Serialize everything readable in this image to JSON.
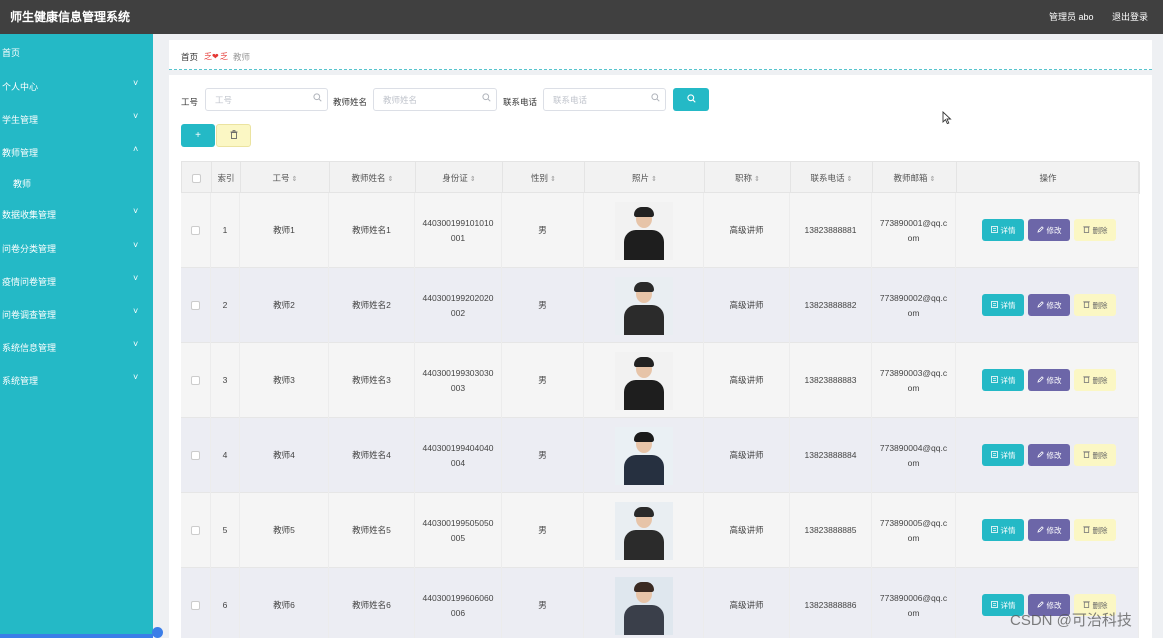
{
  "app": {
    "title": "师生健康信息管理系统",
    "user": "管理员 abo",
    "logout": "退出登录"
  },
  "colors": {
    "accent": "#24b9c6",
    "topbar": "#404040",
    "edit": "#6c66a8",
    "delete": "#fbf7c4"
  },
  "sidebar": {
    "items": [
      {
        "label": "首页",
        "chevron": ""
      },
      {
        "label": "个人中心",
        "chevron": "˅"
      },
      {
        "label": "学生管理",
        "chevron": "˅"
      },
      {
        "label": "教师管理",
        "chevron": "˄"
      },
      {
        "label": "教师",
        "chevron": ""
      },
      {
        "label": "数据收集管理",
        "chevron": "˅"
      },
      {
        "label": "问卷分类管理",
        "chevron": "˅"
      },
      {
        "label": "疫情问卷管理",
        "chevron": "˅"
      },
      {
        "label": "问卷调查管理",
        "chevron": "˅"
      },
      {
        "label": "系统信息管理",
        "chevron": "˅"
      },
      {
        "label": "系统管理",
        "chevron": "˅"
      }
    ]
  },
  "breadcrumb": {
    "home": "首页",
    "separator": "❤",
    "current": "教师"
  },
  "search": {
    "fields": [
      {
        "label": "工号",
        "placeholder": "工号",
        "icon": "search-icon"
      },
      {
        "label": "教师姓名",
        "placeholder": "教师姓名",
        "icon": "search-icon"
      },
      {
        "label": "联系电话",
        "placeholder": "联系电话",
        "icon": "search-icon"
      }
    ],
    "button_icon": "search-icon"
  },
  "toolbar": {
    "add_label": "+",
    "delete_icon": "trash-icon"
  },
  "table": {
    "headers": [
      "",
      "索引",
      "工号",
      "教师姓名",
      "身份证",
      "性别",
      "照片",
      "职称",
      "联系电话",
      "教师邮箱",
      "操作"
    ],
    "sortable": [
      false,
      false,
      true,
      true,
      true,
      true,
      true,
      true,
      true,
      true,
      false
    ],
    "sort_glyph": "⇕",
    "actions": {
      "view": "详情",
      "edit": "修改",
      "delete": "删除"
    },
    "action_icons": {
      "view": "detail-icon",
      "edit": "edit-icon",
      "delete": "trash-icon"
    },
    "rows": [
      {
        "index": "1",
        "id": "教师1",
        "name": "教师姓名1",
        "idcard_1": "440300199101010",
        "idcard_2": "001",
        "gender": "男",
        "title": "高级讲师",
        "phone": "13823888881",
        "email_1": "773890001@qq.c",
        "email_2": "om",
        "photo": "male-dark-suit"
      },
      {
        "index": "2",
        "id": "教师2",
        "name": "教师姓名2",
        "idcard_1": "440300199202020",
        "idcard_2": "002",
        "gender": "男",
        "title": "高级讲师",
        "phone": "13823888882",
        "email_1": "773890002@qq.c",
        "email_2": "om",
        "photo": "female-dark-suit"
      },
      {
        "index": "3",
        "id": "教师3",
        "name": "教师姓名3",
        "idcard_1": "440300199303030",
        "idcard_2": "003",
        "gender": "男",
        "title": "高级讲师",
        "phone": "13823888883",
        "email_1": "773890003@qq.c",
        "email_2": "om",
        "photo": "male-dark-suit"
      },
      {
        "index": "4",
        "id": "教师4",
        "name": "教师姓名4",
        "idcard_1": "440300199404040",
        "idcard_2": "004",
        "gender": "男",
        "title": "高级讲师",
        "phone": "13823888884",
        "email_1": "773890004@qq.c",
        "email_2": "om",
        "photo": "male-light-bg"
      },
      {
        "index": "5",
        "id": "教师5",
        "name": "教师姓名5",
        "idcard_1": "440300199505050",
        "idcard_2": "005",
        "gender": "男",
        "title": "高级讲师",
        "phone": "13823888885",
        "email_1": "773890005@qq.c",
        "email_2": "om",
        "photo": "female-dark-suit"
      },
      {
        "index": "6",
        "id": "教师6",
        "name": "教师姓名6",
        "idcard_1": "440300199606060",
        "idcard_2": "006",
        "gender": "男",
        "title": "高级讲师",
        "phone": "13823888886",
        "email_1": "773890006@qq.c",
        "email_2": "om",
        "photo": "female-light-bg"
      }
    ]
  },
  "watermark": "CSDN @可治科技"
}
